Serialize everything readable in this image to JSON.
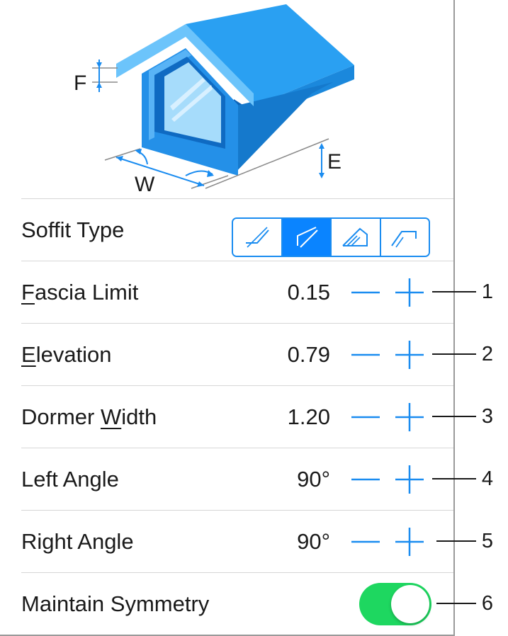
{
  "illustration": {
    "labels": {
      "fascia": "F",
      "elevation": "E",
      "width": "W"
    },
    "colors": {
      "roof": "#2a9df0",
      "roof_light": "#6cc4fb",
      "wall": "#2490e8",
      "wall_dark": "#0d63b8",
      "glass": "#a6dcfb"
    }
  },
  "soffit": {
    "label": "Soffit Type",
    "options": [
      {
        "name": "soffit-type-1",
        "selected": false
      },
      {
        "name": "soffit-type-2",
        "selected": true
      },
      {
        "name": "soffit-type-3",
        "selected": false
      },
      {
        "name": "soffit-type-4",
        "selected": false
      }
    ]
  },
  "rows": [
    {
      "label_pre": "",
      "label_u": "F",
      "label_post": "ascia Limit",
      "value": "0.15",
      "callout": "1"
    },
    {
      "label_pre": "",
      "label_u": "E",
      "label_post": "levation",
      "value": "0.79",
      "callout": "2"
    },
    {
      "label_pre": "Dormer ",
      "label_u": "W",
      "label_post": "idth",
      "value": "1.20",
      "callout": "3"
    },
    {
      "label_pre": "Left Angle",
      "label_u": "",
      "label_post": "",
      "value": "90°",
      "callout": "4"
    },
    {
      "label_pre": "Right Angle",
      "label_u": "",
      "label_post": "",
      "value": "90°",
      "callout": "5"
    }
  ],
  "symmetry": {
    "label": "Maintain Symmetry",
    "on": true,
    "callout": "6"
  },
  "theme": {
    "accent": "#0a84ff",
    "toggle_on": "#1ed760",
    "divider": "#d6d6d6"
  }
}
